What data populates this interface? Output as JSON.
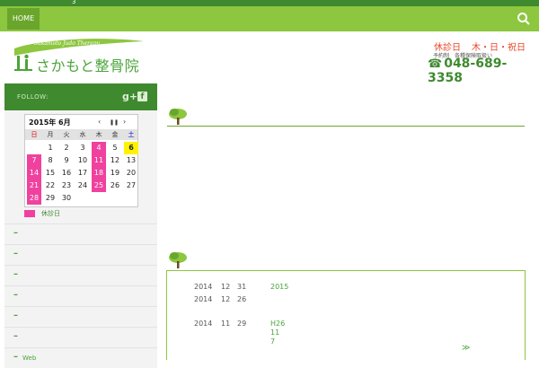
{
  "topstrip": {
    "text": "3"
  },
  "nav": {
    "home": "HOME",
    "search_icon": "search-icon"
  },
  "header": {
    "logo_en": "Sakamoto Judo Therapy",
    "logo_ja": "さかもと整骨院",
    "closed_label": "休診日",
    "closed_days": "木・日・祝日",
    "sub_reserve": "予約制",
    "sub_insurance": "各種保険取扱い",
    "phone": "048-689-3358",
    "colors": {
      "brand_green": "#4aa43a",
      "dark_green": "#3f8a2f",
      "nav_green": "#8dc63f",
      "accent_red": "#e8472a"
    }
  },
  "follow": {
    "label": "FOLLOW:",
    "gplus": "g+",
    "facebook": "f"
  },
  "calendar": {
    "title": "2015年 6月",
    "prev": "‹",
    "pause": "❚❚",
    "next": "›",
    "dow": [
      "日",
      "月",
      "火",
      "水",
      "木",
      "金",
      "土"
    ],
    "rows": [
      [
        "",
        "1",
        "2",
        "3",
        "4",
        "5",
        "6"
      ],
      [
        "7",
        "8",
        "9",
        "10",
        "11",
        "12",
        "13"
      ],
      [
        "14",
        "15",
        "16",
        "17",
        "18",
        "19",
        "20"
      ],
      [
        "21",
        "22",
        "23",
        "24",
        "25",
        "26",
        "27"
      ],
      [
        "28",
        "29",
        "30",
        "",
        "",
        "",
        ""
      ]
    ],
    "legend": "休診日"
  },
  "menu": [
    {
      "label": ""
    },
    {
      "label": ""
    },
    {
      "label": ""
    },
    {
      "label": ""
    },
    {
      "label": ""
    },
    {
      "label": ""
    },
    {
      "label": "Web"
    }
  ],
  "news": [
    {
      "y": "2014",
      "m": "12",
      "d": "31",
      "title": "2015"
    },
    {
      "y": "2014",
      "m": "12",
      "d": "26",
      "title": ""
    },
    {
      "y": "2014",
      "m": "11",
      "d": "29",
      "title": "H26 11　7"
    }
  ],
  "more": "≫"
}
